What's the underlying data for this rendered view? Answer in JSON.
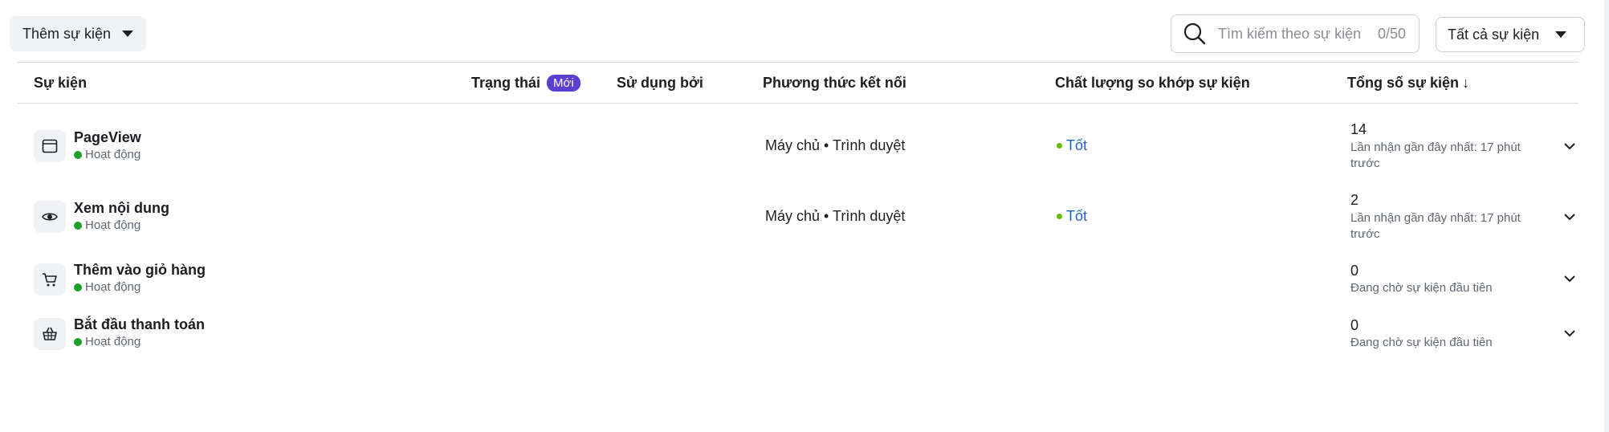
{
  "toolbar": {
    "add_event_label": "Thêm sự kiện",
    "search_placeholder": "Tìm kiếm theo sự kiện",
    "search_counter": "0/50",
    "filter_label": "Tất cả sự kiện"
  },
  "table": {
    "headers": {
      "event": "Sự kiện",
      "status": "Trạng thái",
      "status_badge": "Mới",
      "used_by": "Sử dụng bởi",
      "connection": "Phương thức kết nối",
      "match_quality": "Chất lượng so khớp sự kiện",
      "total": "Tổng số sự kiện"
    },
    "rows": [
      {
        "icon": "browser-window-icon",
        "name": "PageView",
        "status": "Hoạt động",
        "connection": "Máy chủ • Trình duyệt",
        "quality": "Tốt",
        "total": "14",
        "total_sub": "Lần nhận gần đây nhất: 17 phút trước"
      },
      {
        "icon": "eye-icon",
        "name": "Xem nội dung",
        "status": "Hoạt động",
        "connection": "Máy chủ • Trình duyệt",
        "quality": "Tốt",
        "total": "2",
        "total_sub": "Lần nhận gần đây nhất: 17 phút trước"
      },
      {
        "icon": "cart-icon",
        "name": "Thêm vào giỏ hàng",
        "status": "Hoạt động",
        "connection": "",
        "quality": "",
        "total": "0",
        "total_sub": "Đang chờ sự kiện đầu tiên"
      },
      {
        "icon": "basket-icon",
        "name": "Bắt đầu thanh toán",
        "status": "Hoạt động",
        "connection": "",
        "quality": "",
        "total": "0",
        "total_sub": "Đang chờ sự kiện đầu tiên"
      }
    ]
  },
  "colors": {
    "badge": "#5b3fd1",
    "active_dot": "#1da12b",
    "quality_dot": "#63be09",
    "quality_text": "#1c62cf"
  }
}
